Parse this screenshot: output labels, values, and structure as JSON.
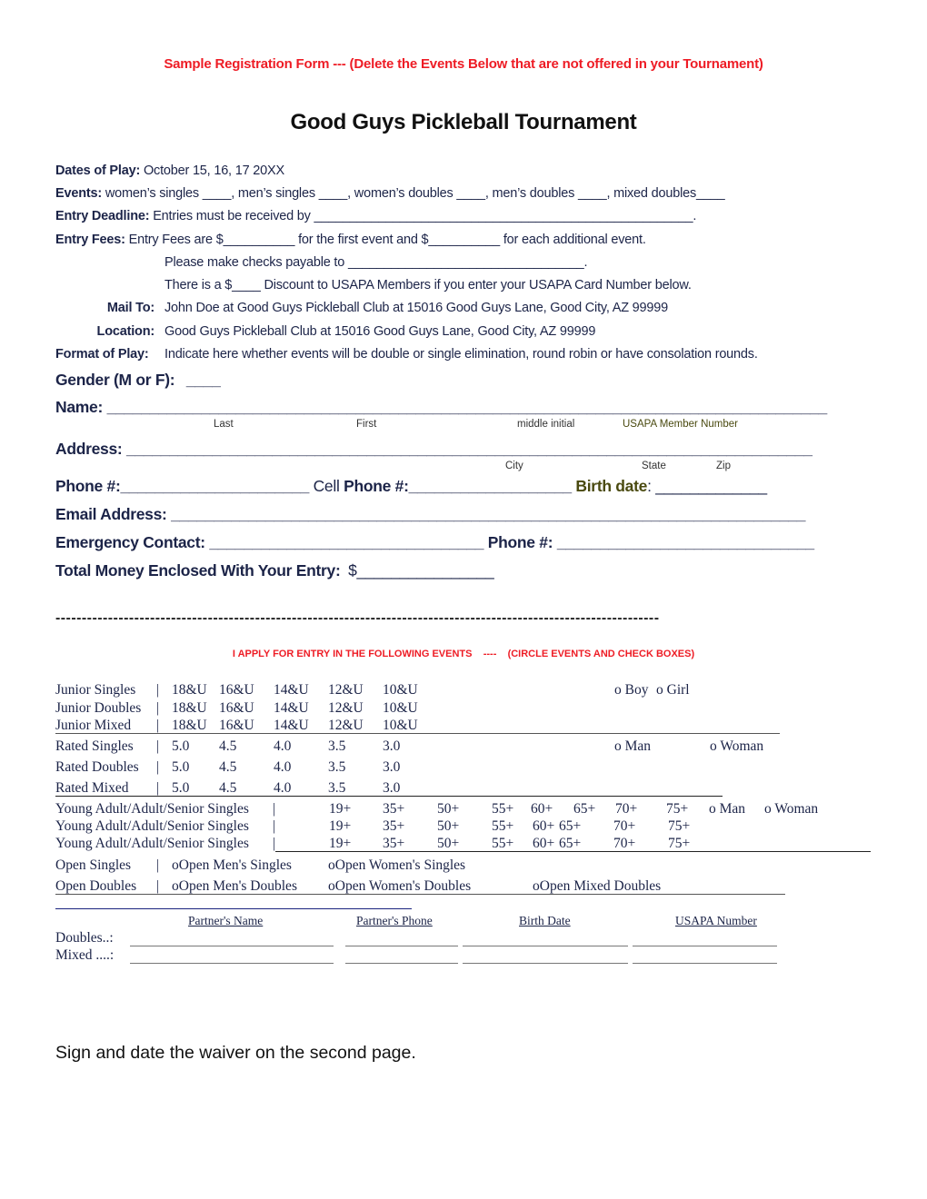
{
  "header": {
    "note": "Sample Registration Form --- (Delete the Events Below that are not offered in your Tournament)",
    "title": "Good Guys Pickleball Tournament"
  },
  "info": {
    "dates_label": "Dates of Play:",
    "dates_value": "October 15, 16, 17 20XX",
    "events_label": "Events:",
    "events_value": "women’s singles ____, men’s singles ____, women’s doubles ____, men’s doubles ____, mixed doubles____",
    "deadline_label": "Entry Deadline:",
    "deadline_value": "Entries must be received by _____________________________________________________.",
    "fees_label": "Entry Fees:",
    "fees_value": "Entry Fees are $__________ for the first event and $__________ for each additional event.",
    "checks": "Please make checks payable to _________________________________.",
    "discount": "There is a $____ Discount to USAPA Members if you enter your USAPA Card Number below.",
    "mail_label": "Mail To:",
    "mail_value": "John Doe at Good Guys Pickleball Club at 15016 Good Guys Lane, Good City, AZ 99999",
    "location_label": "Location:",
    "location_value": "Good Guys Pickleball Club at 15016 Good Guys Lane, Good City, AZ 99999",
    "format_label": "Format of Play:",
    "format_value": "Indicate here whether events will be double or single elimination, round robin or have consolation rounds."
  },
  "form": {
    "gender_label": "Gender (M or F):",
    "gender_blank": "____",
    "name_label": "Name:",
    "name_blank": "____________________________________________________________________________________",
    "name_sub": {
      "last": "Last",
      "first": "First",
      "middle": "middle initial",
      "usapa": "USAPA Member Number"
    },
    "address_label": "Address:",
    "address_blank": "________________________________________________________________________________",
    "address_sub": {
      "city": "City",
      "state": "State",
      "zip": "Zip"
    },
    "phone_label": "Phone #:",
    "phone_blank": "______________________",
    "cell_prefix": "Cell",
    "cell_label": "Phone #:",
    "cell_blank": "___________________",
    "birth_label": "Birth date",
    "birth_colon": ":",
    "birth_blank": "_____________",
    "email_label": "Email Address:",
    "email_blank": "__________________________________________________________________________",
    "emergency_label": "Emergency Contact:",
    "emergency_blank": "________________________________",
    "emergency_phone_label": "Phone #:",
    "emergency_phone_blank": "______________________________",
    "total_label": "Total Money Enclosed With Your Entry:",
    "total_blank": "$________________"
  },
  "separator": "-------------------------------------------------------------------------------------------------------------------",
  "apply_heading": "I APPLY FOR ENTRY IN THE FOLLOWING EVENTS    ----    (CIRCLE EVENTS AND CHECK BOXES)",
  "events": {
    "junior": [
      {
        "name": "Junior Singles",
        "options": [
          "18&U",
          "16&U",
          "14&U",
          "12&U",
          "10&U"
        ]
      },
      {
        "name": "Junior Doubles",
        "options": [
          "18&U",
          "16&U",
          "14&U",
          "12&U",
          "10&U"
        ]
      },
      {
        "name": "Junior Mixed",
        "options": [
          "18&U",
          "16&U",
          "14&U",
          "12&U",
          "10&U"
        ]
      }
    ],
    "junior_gender": [
      "Boy",
      "Girl"
    ],
    "rated": [
      {
        "name": "Rated Singles",
        "options": [
          "5.0",
          "4.5",
          "4.0",
          "3.5",
          "3.0"
        ]
      },
      {
        "name": "Rated Doubles",
        "options": [
          "5.0",
          "4.5",
          "4.0",
          "3.5",
          "3.0"
        ]
      },
      {
        "name": "Rated Mixed",
        "options": [
          "5.0",
          "4.5",
          "4.0",
          "3.5",
          "3.0"
        ]
      }
    ],
    "rated_gender": [
      "Man",
      "Woman"
    ],
    "age": [
      {
        "name": "Young Adult/Adult/Senior Singles",
        "options": [
          "19+",
          "35+",
          "50+",
          "55+",
          "60+",
          "65+",
          "70+",
          "75+"
        ]
      },
      {
        "name": "Young Adult/Adult/Senior Singles",
        "options": [
          "19+",
          "35+",
          "50+",
          "55+",
          "60+",
          "65+",
          "70+",
          "75+"
        ]
      },
      {
        "name": "Young Adult/Adult/Senior Singles",
        "options": [
          "19+",
          "35+",
          "50+",
          "55+",
          "60+",
          "65+",
          "70+",
          "75+"
        ]
      }
    ],
    "age_gender": [
      "Man",
      "Woman"
    ],
    "open_singles": {
      "name": "Open Singles",
      "options": [
        "Open Men's Singles",
        "Open Women's Singles"
      ]
    },
    "open_doubles": {
      "name": "Open Doubles",
      "options": [
        "Open Men's Doubles",
        "Open Women's Doubles",
        "Open Mixed Doubles"
      ]
    },
    "separator": "|",
    "checkbox_glyph": "o"
  },
  "partners": {
    "headers": [
      "Partner's Name",
      "Partner's Phone",
      "Birth Date",
      "USAPA Number"
    ],
    "rows": [
      {
        "label": "Doubles..:"
      },
      {
        "label": "Mixed ....:"
      }
    ]
  },
  "closing": "Sign and date the waiver on the second page."
}
